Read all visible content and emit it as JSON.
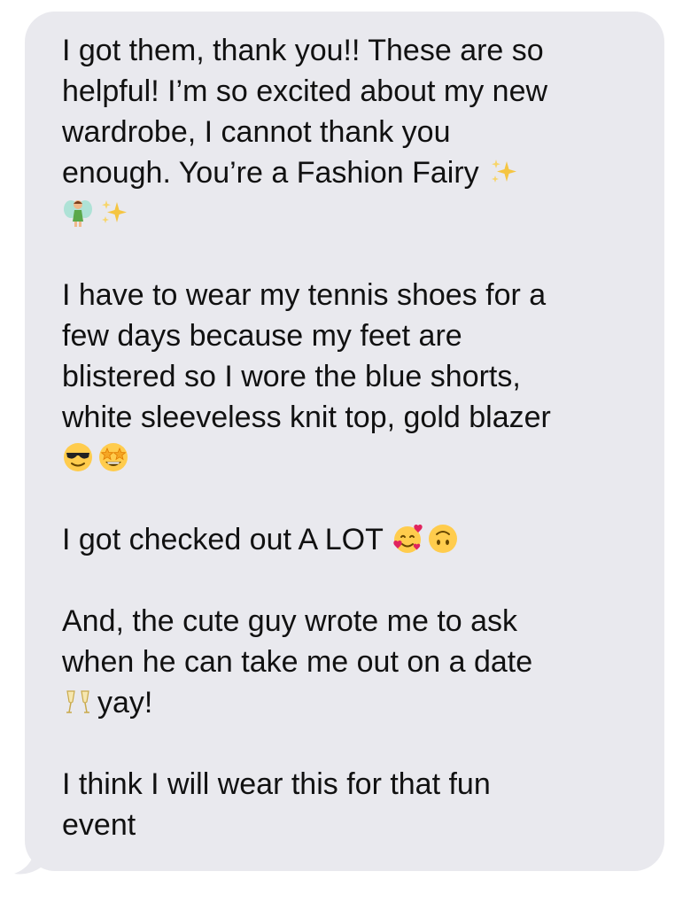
{
  "message": {
    "lines_p1": [
      "I got them, thank you!! These are so",
      "helpful! I’m so excited about my new",
      "wardrobe, I cannot thank you",
      "enough. You’re a Fashion Fairy "
    ],
    "p2": [
      "I have to wear my tennis shoes for a",
      "few days because my feet are",
      "blistered so I wore the blue shorts,",
      "white sleeveless knit top, gold blazer"
    ],
    "p3": "I got checked out A LOT ",
    "p4": [
      "And, the cute guy wrote me to ask",
      "when he can take me out on a date",
      "yay!"
    ],
    "p5": [
      "I think I will wear this for that fun",
      "event"
    ]
  },
  "emojis": {
    "sparkles": "sparkles-icon",
    "fairy": "fairy-icon",
    "sunglasses": "sunglasses-face-icon",
    "star_struck": "star-struck-face-icon",
    "smiling_hearts": "smiling-face-with-hearts-icon",
    "upside_down": "upside-down-face-icon",
    "champagne": "clinking-glasses-icon"
  },
  "colors": {
    "bubble": "#e9e9ee",
    "text": "#111111"
  }
}
